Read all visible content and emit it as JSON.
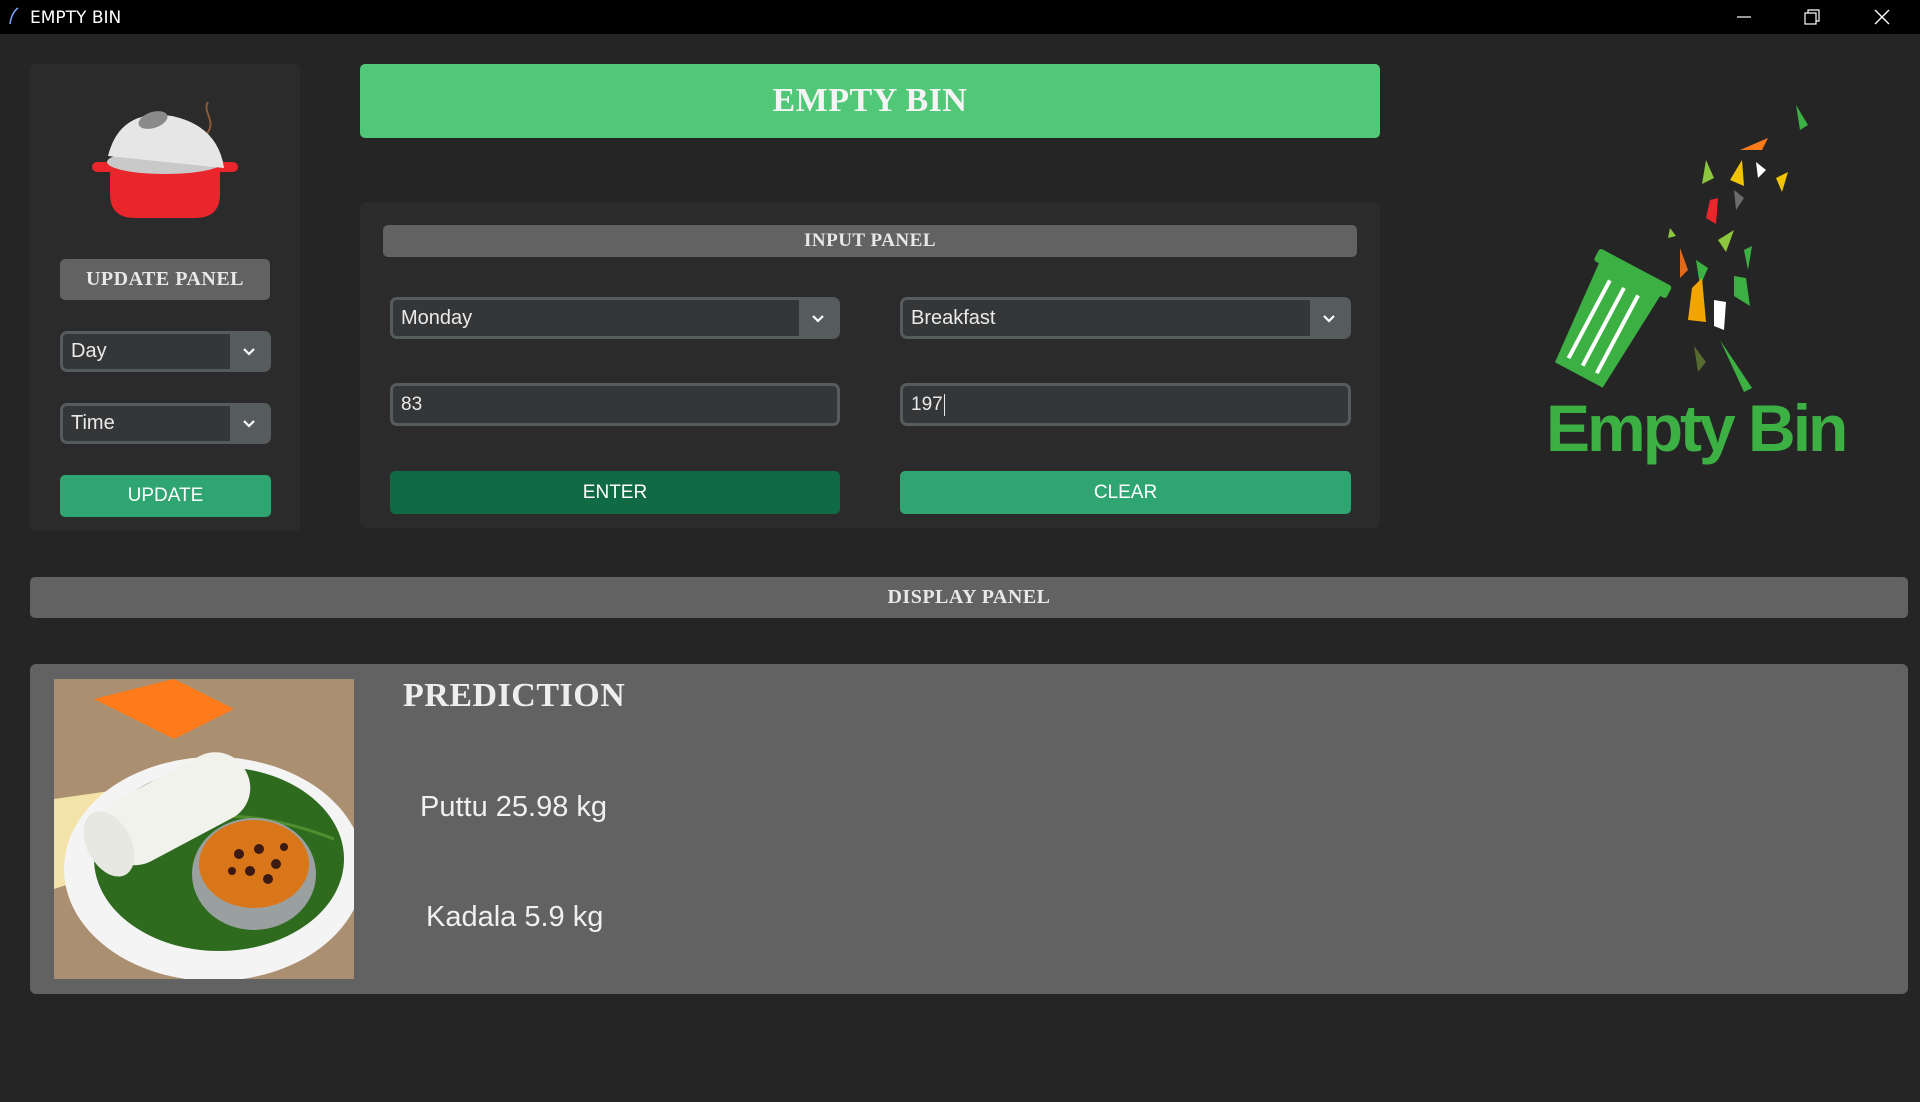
{
  "window": {
    "title": "EMPTY BIN"
  },
  "update_panel": {
    "heading": "UPDATE PANEL",
    "day_select": "Day",
    "time_select": "Time",
    "update_button": "UPDATE"
  },
  "header": {
    "title": "EMPTY BIN"
  },
  "input_panel": {
    "heading": "INPUT PANEL",
    "day_select": "Monday",
    "meal_select": "Breakfast",
    "left_entry": "83",
    "right_entry": "197",
    "enter_button": "ENTER",
    "clear_button": "CLEAR"
  },
  "logo": {
    "text": "Empty Bin"
  },
  "display_panel": {
    "heading": "DISPLAY PANEL",
    "prediction_title": "PREDICTION",
    "items": [
      {
        "text": "Puttu 25.98 kg"
      },
      {
        "text": "Kadala 5.9 kg"
      }
    ]
  },
  "icons": {
    "pot": "cooking-pot-icon",
    "dropdown": "chevron-down-icon",
    "logo": "empty-bin-logo",
    "food": "puttu-kadala-photo"
  },
  "colors": {
    "accent_green": "#50c878",
    "button_green": "#2fa572",
    "button_green_dark": "#106a43",
    "bar_gray": "#626262",
    "background": "#252525"
  }
}
